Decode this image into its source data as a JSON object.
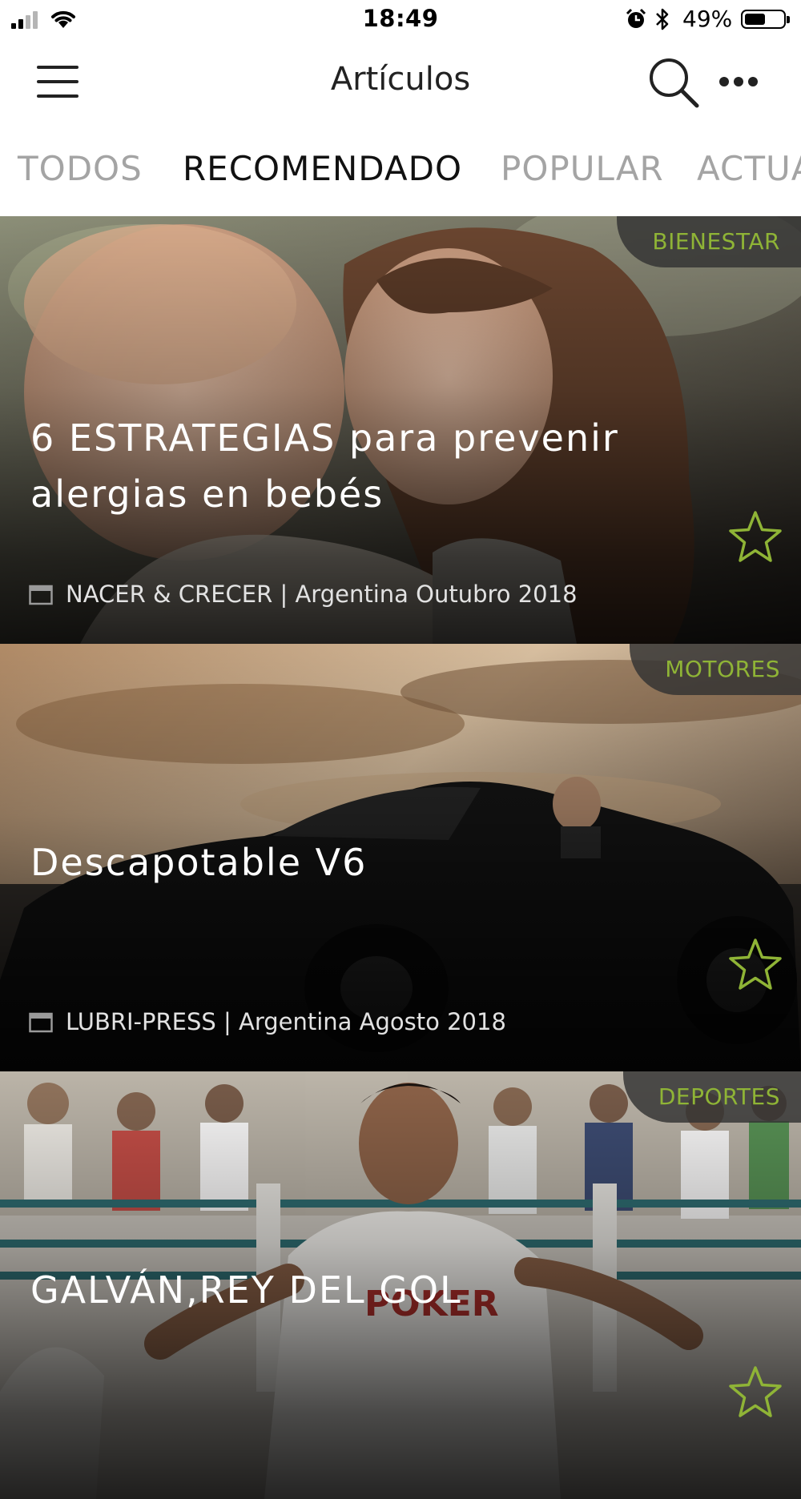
{
  "status_bar": {
    "time": "18:49",
    "battery_percent": "49%",
    "battery_level": 0.49,
    "icons": [
      "signal-icon",
      "wifi-icon",
      "alarm-icon",
      "bluetooth-icon",
      "battery-icon"
    ]
  },
  "nav": {
    "title": "Artículos",
    "icons": [
      "menu-icon",
      "search-icon",
      "more-icon"
    ]
  },
  "tabs": [
    {
      "label": "TODOS",
      "active": false
    },
    {
      "label": "RECOMENDADO",
      "active": true
    },
    {
      "label": "POPULAR",
      "active": false
    },
    {
      "label": "ACTUA",
      "active": false
    }
  ],
  "colors": {
    "accent_green": "#8fb436",
    "tab_inactive": "#a4a4a4",
    "tab_active": "#111111"
  },
  "articles": [
    {
      "category": "BIENESTAR",
      "title": "6 ESTRATEGIAS para prevenir alergias en bebés",
      "meta": "NACER & CRECER | Argentina Outubro 2018",
      "image": "mother-and-baby-photo"
    },
    {
      "category": "MOTORES",
      "title": "Descapotable V6",
      "meta": "LUBRI-PRESS | Argentina Agosto 2018",
      "image": "black-convertible-car-photo"
    },
    {
      "category": "DEPORTES",
      "title": "GALVÁN,REY DEL GOL",
      "meta": "",
      "image": "football-player-celebrating-photo"
    }
  ]
}
